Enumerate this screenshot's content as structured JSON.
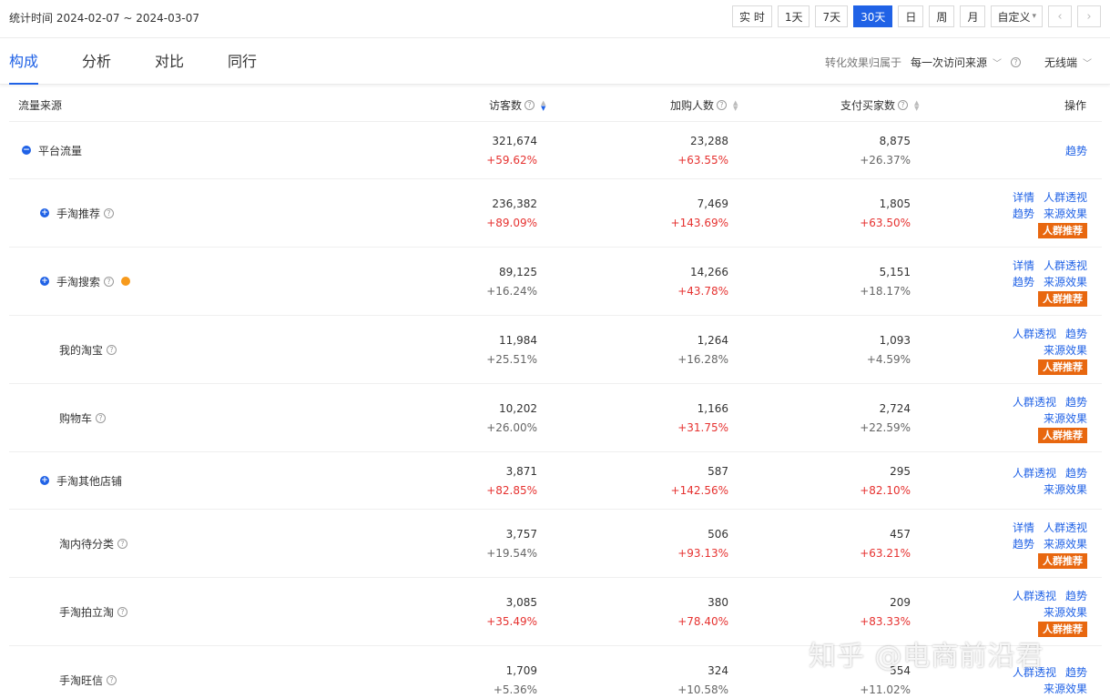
{
  "header": {
    "stat_time": "统计时间 2024-02-07 ~ 2024-03-07",
    "ranges": [
      "实 时",
      "1天",
      "7天",
      "30天",
      "日",
      "周",
      "月"
    ],
    "active_range": "30天",
    "custom_label": "自定义",
    "prev_icon": "chevron-left-icon",
    "next_icon": "chevron-right-icon"
  },
  "tabs": [
    "构成",
    "分析",
    "对比",
    "同行"
  ],
  "active_tab": "构成",
  "attribution": {
    "label": "转化效果归属于",
    "value": "每一次访问来源",
    "device": "无线端"
  },
  "columns": {
    "source": "流量来源",
    "visitors": "访客数",
    "cart": "加购人数",
    "buyers": "支付买家数",
    "ops": "操作"
  },
  "rows": [
    {
      "name": "平台流量",
      "visitors": "321,674",
      "visitors_pct": "+59.62%",
      "cart": "23,288",
      "cart_pct": "+63.55%",
      "buyers": "8,875",
      "buyers_pct": "+26.37%",
      "ops": [
        "趋势"
      ]
    },
    {
      "name": "手淘推荐",
      "visitors": "236,382",
      "visitors_pct": "+89.09%",
      "cart": "7,469",
      "cart_pct": "+143.69%",
      "buyers": "1,805",
      "buyers_pct": "+63.50%",
      "ops": [
        "详情",
        "人群透视",
        "趋势",
        "来源效果"
      ],
      "badge": "人群推荐"
    },
    {
      "name": "手淘搜索",
      "visitors": "89,125",
      "visitors_pct": "+16.24%",
      "cart": "14,266",
      "cart_pct": "+43.78%",
      "buyers": "5,151",
      "buyers_pct": "+18.17%",
      "ops": [
        "详情",
        "人群透视",
        "趋势",
        "来源效果"
      ],
      "badge": "人群推荐"
    },
    {
      "name": "我的淘宝",
      "visitors": "11,984",
      "visitors_pct": "+25.51%",
      "cart": "1,264",
      "cart_pct": "+16.28%",
      "buyers": "1,093",
      "buyers_pct": "+4.59%",
      "ops": [
        "人群透视",
        "趋势",
        "来源效果"
      ],
      "badge": "人群推荐"
    },
    {
      "name": "购物车",
      "visitors": "10,202",
      "visitors_pct": "+26.00%",
      "cart": "1,166",
      "cart_pct": "+31.75%",
      "buyers": "2,724",
      "buyers_pct": "+22.59%",
      "ops": [
        "人群透视",
        "趋势",
        "来源效果"
      ],
      "badge": "人群推荐"
    },
    {
      "name": "手淘其他店铺",
      "visitors": "3,871",
      "visitors_pct": "+82.85%",
      "cart": "587",
      "cart_pct": "+142.56%",
      "buyers": "295",
      "buyers_pct": "+82.10%",
      "ops": [
        "人群透视",
        "趋势",
        "来源效果"
      ]
    },
    {
      "name": "淘内待分类",
      "visitors": "3,757",
      "visitors_pct": "+19.54%",
      "cart": "506",
      "cart_pct": "+93.13%",
      "buyers": "457",
      "buyers_pct": "+63.21%",
      "ops": [
        "详情",
        "人群透视",
        "趋势",
        "来源效果"
      ],
      "badge": "人群推荐"
    },
    {
      "name": "手淘拍立淘",
      "visitors": "3,085",
      "visitors_pct": "+35.49%",
      "cart": "380",
      "cart_pct": "+78.40%",
      "buyers": "209",
      "buyers_pct": "+83.33%",
      "ops": [
        "人群透视",
        "趋势",
        "来源效果"
      ],
      "badge": "人群推荐"
    },
    {
      "name": "手淘旺信",
      "visitors": "1,709",
      "visitors_pct": "+5.36%",
      "cart": "324",
      "cart_pct": "+10.58%",
      "buyers": "554",
      "buyers_pct": "+11.02%",
      "ops": [
        "人群透视",
        "趋势",
        "来源效果"
      ]
    }
  ],
  "watermark": "知乎 @电商前沿君",
  "colors": {
    "accent": "#2062e6",
    "up": "#e63230",
    "badge": "#e8670f",
    "dot": "#f79a1c"
  }
}
